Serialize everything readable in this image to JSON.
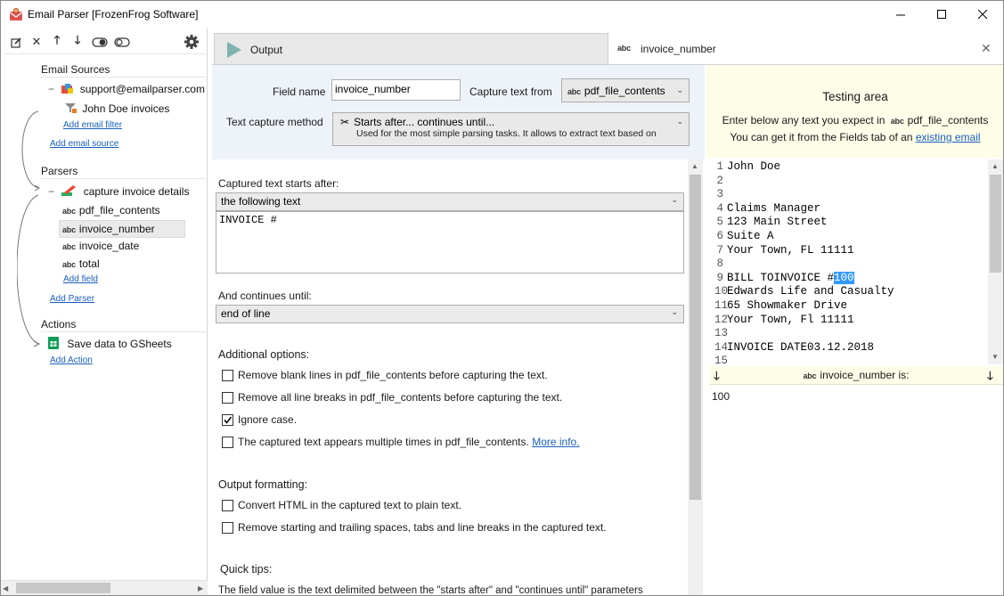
{
  "window": {
    "title": "Email Parser [FrozenFrog Software]"
  },
  "left": {
    "email_sources_label": "Email Sources",
    "account": "support@emailparser.com",
    "filter_name": "John Doe invoices",
    "add_email_filter": "Add email filter",
    "add_email_source": "Add email source",
    "parsers_label": "Parsers",
    "parser_name": "capture invoice details",
    "fields": [
      "pdf_file_contents",
      "invoice_number",
      "invoice_date",
      "total"
    ],
    "add_field": "Add field",
    "add_parser": "Add Parser",
    "actions_label": "Actions",
    "action_name": "Save data to GSheets",
    "add_action": "Add Action"
  },
  "tabs": {
    "output": "Output",
    "field_tab": "invoice_number",
    "abc": "abc"
  },
  "config": {
    "field_name_label": "Field name",
    "field_name_value": "invoice_number",
    "capture_from_label": "Capture text from",
    "capture_from_value": "pdf_file_contents",
    "method_label": "Text capture method",
    "method_title": "Starts after... continues until...",
    "method_desc": "Used for the most simple parsing tasks. It allows to extract text based on",
    "starts_after_label": "Captured text starts after:",
    "starts_after_value": "the following text",
    "starts_after_text": "INVOICE #",
    "continues_label": "And continues until:",
    "continues_value": "end of line",
    "additional_label": "Additional options:",
    "opt1": "Remove blank lines in pdf_file_contents before capturing the text.",
    "opt2": "Remove all line breaks in pdf_file_contents before capturing the text.",
    "opt3": "Ignore case.",
    "opt4": "The captured text appears multiple times in pdf_file_contents.",
    "opt4_link": "More info.",
    "output_fmt_label": "Output formatting:",
    "fmt1": "Convert HTML in the captured text to plain text.",
    "fmt2": "Remove starting and trailing spaces, tabs and line breaks in the captured text.",
    "tips_label": "Quick tips:",
    "tips_text": "The field value is the text delimited between the \"starts after\" and \"continues until\" parameters"
  },
  "testing": {
    "title": "Testing area",
    "line1_pre": "Enter below any text you expect in",
    "line1_field": "pdf_file_contents",
    "line2_pre": "You can get it from the Fields tab of an",
    "line2_link": "existing email",
    "lines": [
      {
        "n": "1",
        "t": "John Doe"
      },
      {
        "n": "2",
        "t": ""
      },
      {
        "n": "3",
        "t": ""
      },
      {
        "n": "4",
        "t": "Claims Manager"
      },
      {
        "n": "5",
        "t": "123 Main Street"
      },
      {
        "n": "6",
        "t": "Suite A"
      },
      {
        "n": "7",
        "t": "Your Town, FL 11111"
      },
      {
        "n": "8",
        "t": ""
      },
      {
        "n": "9",
        "t": "BILL TOINVOICE #"
      },
      {
        "n": "10",
        "t": "Edwards Life and Casualty"
      },
      {
        "n": "11",
        "t": "65 Showmaker Drive"
      },
      {
        "n": "12",
        "t": "Your Town, Fl 11111"
      },
      {
        "n": "13",
        "t": ""
      },
      {
        "n": "14",
        "t": "INVOICE DATE03.12.2018"
      },
      {
        "n": "15",
        "t": ""
      }
    ],
    "highlight": "100",
    "result_label": "invoice_number is:",
    "result_value": "100"
  }
}
